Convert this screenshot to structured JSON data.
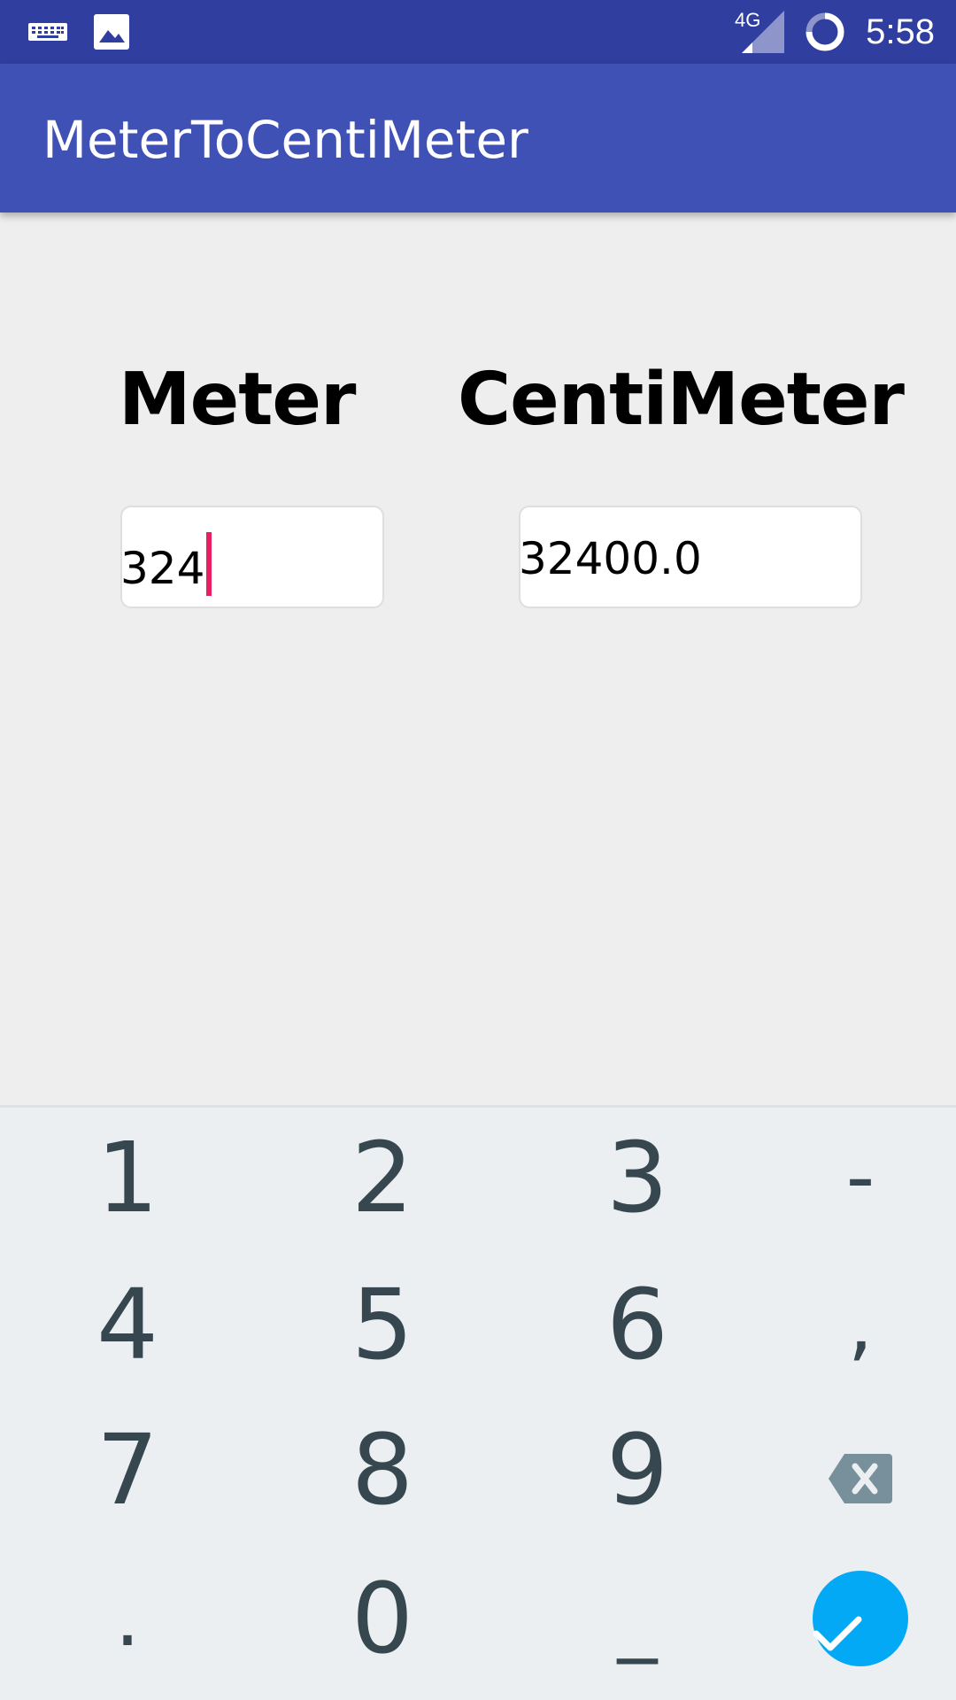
{
  "status_bar": {
    "time": "5:58",
    "network_label": "4G",
    "icons": [
      "keyboard-icon",
      "image-icon",
      "signal-icon",
      "sync-icon"
    ]
  },
  "app_bar": {
    "title": "MeterToCentiMeter",
    "color": "#3f51b5"
  },
  "converter": {
    "meter_label": "Meter",
    "centimeter_label": "CentiMeter",
    "meter_value": "324",
    "centimeter_value": "32400.0"
  },
  "keyboard": {
    "keys": [
      "1",
      "2",
      "3",
      "-",
      "4",
      "5",
      "6",
      ",",
      "7",
      "8",
      "9",
      ".",
      "0",
      "_"
    ],
    "backspace_icon": "backspace-icon",
    "done_icon": "checkmark-icon",
    "done_color": "#03a9f4",
    "key_text_color": "#37474f"
  },
  "colors": {
    "status_bar": "#303f9f",
    "cursor": "#e91e63",
    "background": "#eeeeee"
  }
}
